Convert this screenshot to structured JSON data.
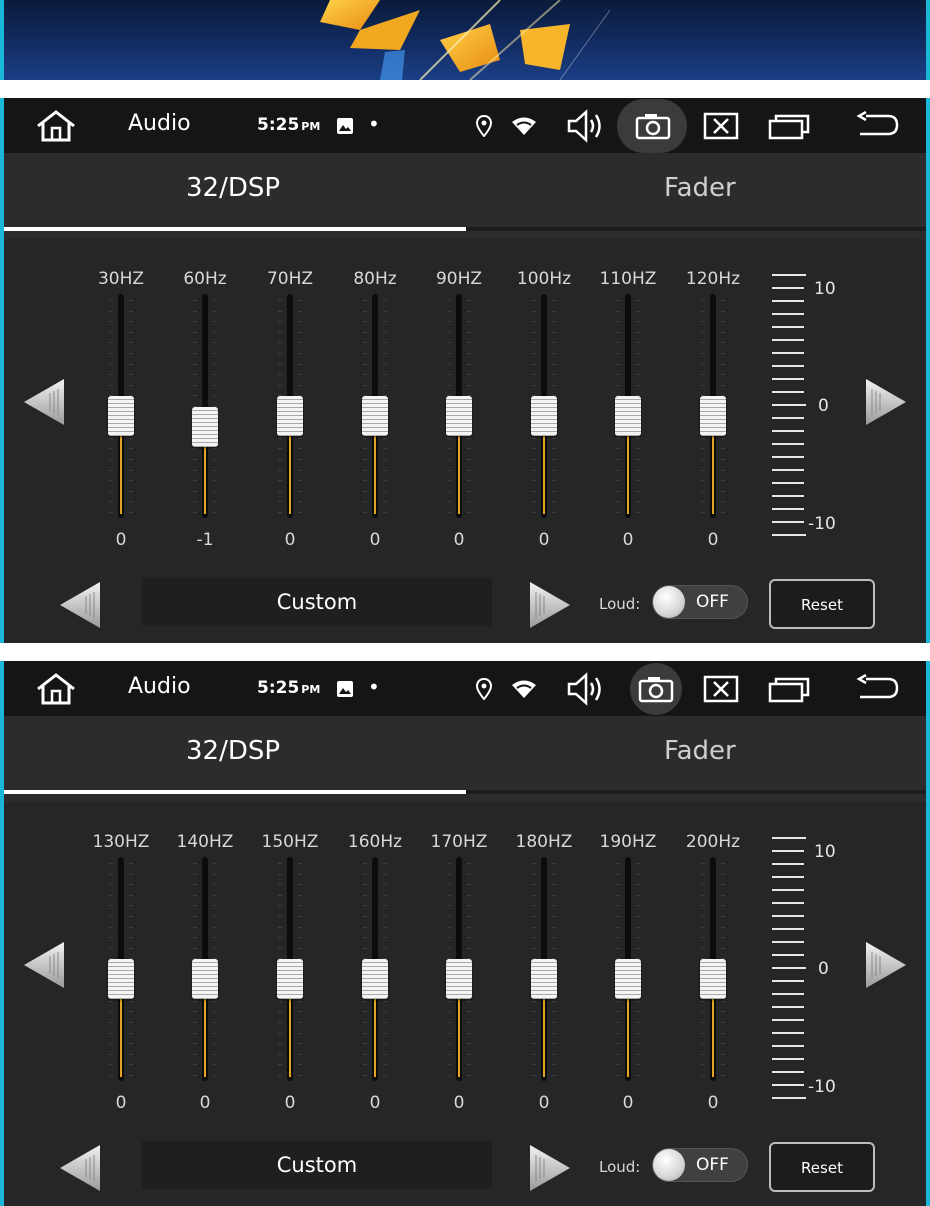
{
  "status_bar": {
    "app_title": "Audio",
    "time": "5:25",
    "ampm": "PM",
    "dot": "•",
    "icons": [
      "home-icon",
      "gallery-icon",
      "location-icon",
      "wifi-icon",
      "volume-icon",
      "camera-icon",
      "close-window-icon",
      "recent-apps-icon",
      "back-icon"
    ]
  },
  "tabs": [
    {
      "label": "32/DSP",
      "active": true
    },
    {
      "label": "Fader",
      "active": false
    }
  ],
  "scale": {
    "top": "10",
    "mid": "0",
    "bottom": "-10"
  },
  "panels": [
    {
      "bands": [
        {
          "freq": "30HZ",
          "value": "0"
        },
        {
          "freq": "60Hz",
          "value": "-1"
        },
        {
          "freq": "70HZ",
          "value": "0"
        },
        {
          "freq": "80Hz",
          "value": "0"
        },
        {
          "freq": "90HZ",
          "value": "0"
        },
        {
          "freq": "100Hz",
          "value": "0"
        },
        {
          "freq": "110HZ",
          "value": "0"
        },
        {
          "freq": "120Hz",
          "value": "0"
        }
      ],
      "preset": "Custom",
      "loud_label": "Loud:",
      "loud_state": "OFF",
      "reset_label": "Reset"
    },
    {
      "bands": [
        {
          "freq": "130HZ",
          "value": "0"
        },
        {
          "freq": "140HZ",
          "value": "0"
        },
        {
          "freq": "150HZ",
          "value": "0"
        },
        {
          "freq": "160Hz",
          "value": "0"
        },
        {
          "freq": "170HZ",
          "value": "0"
        },
        {
          "freq": "180HZ",
          "value": "0"
        },
        {
          "freq": "190HZ",
          "value": "0"
        },
        {
          "freq": "200Hz",
          "value": "0"
        }
      ],
      "preset": "Custom",
      "loud_label": "Loud:",
      "loud_state": "OFF",
      "reset_label": "Reset"
    }
  ],
  "colors": {
    "accent": "#e0a623",
    "edge": "#19b7d8",
    "panel_bg": "#252628",
    "status_bg": "#141516"
  }
}
